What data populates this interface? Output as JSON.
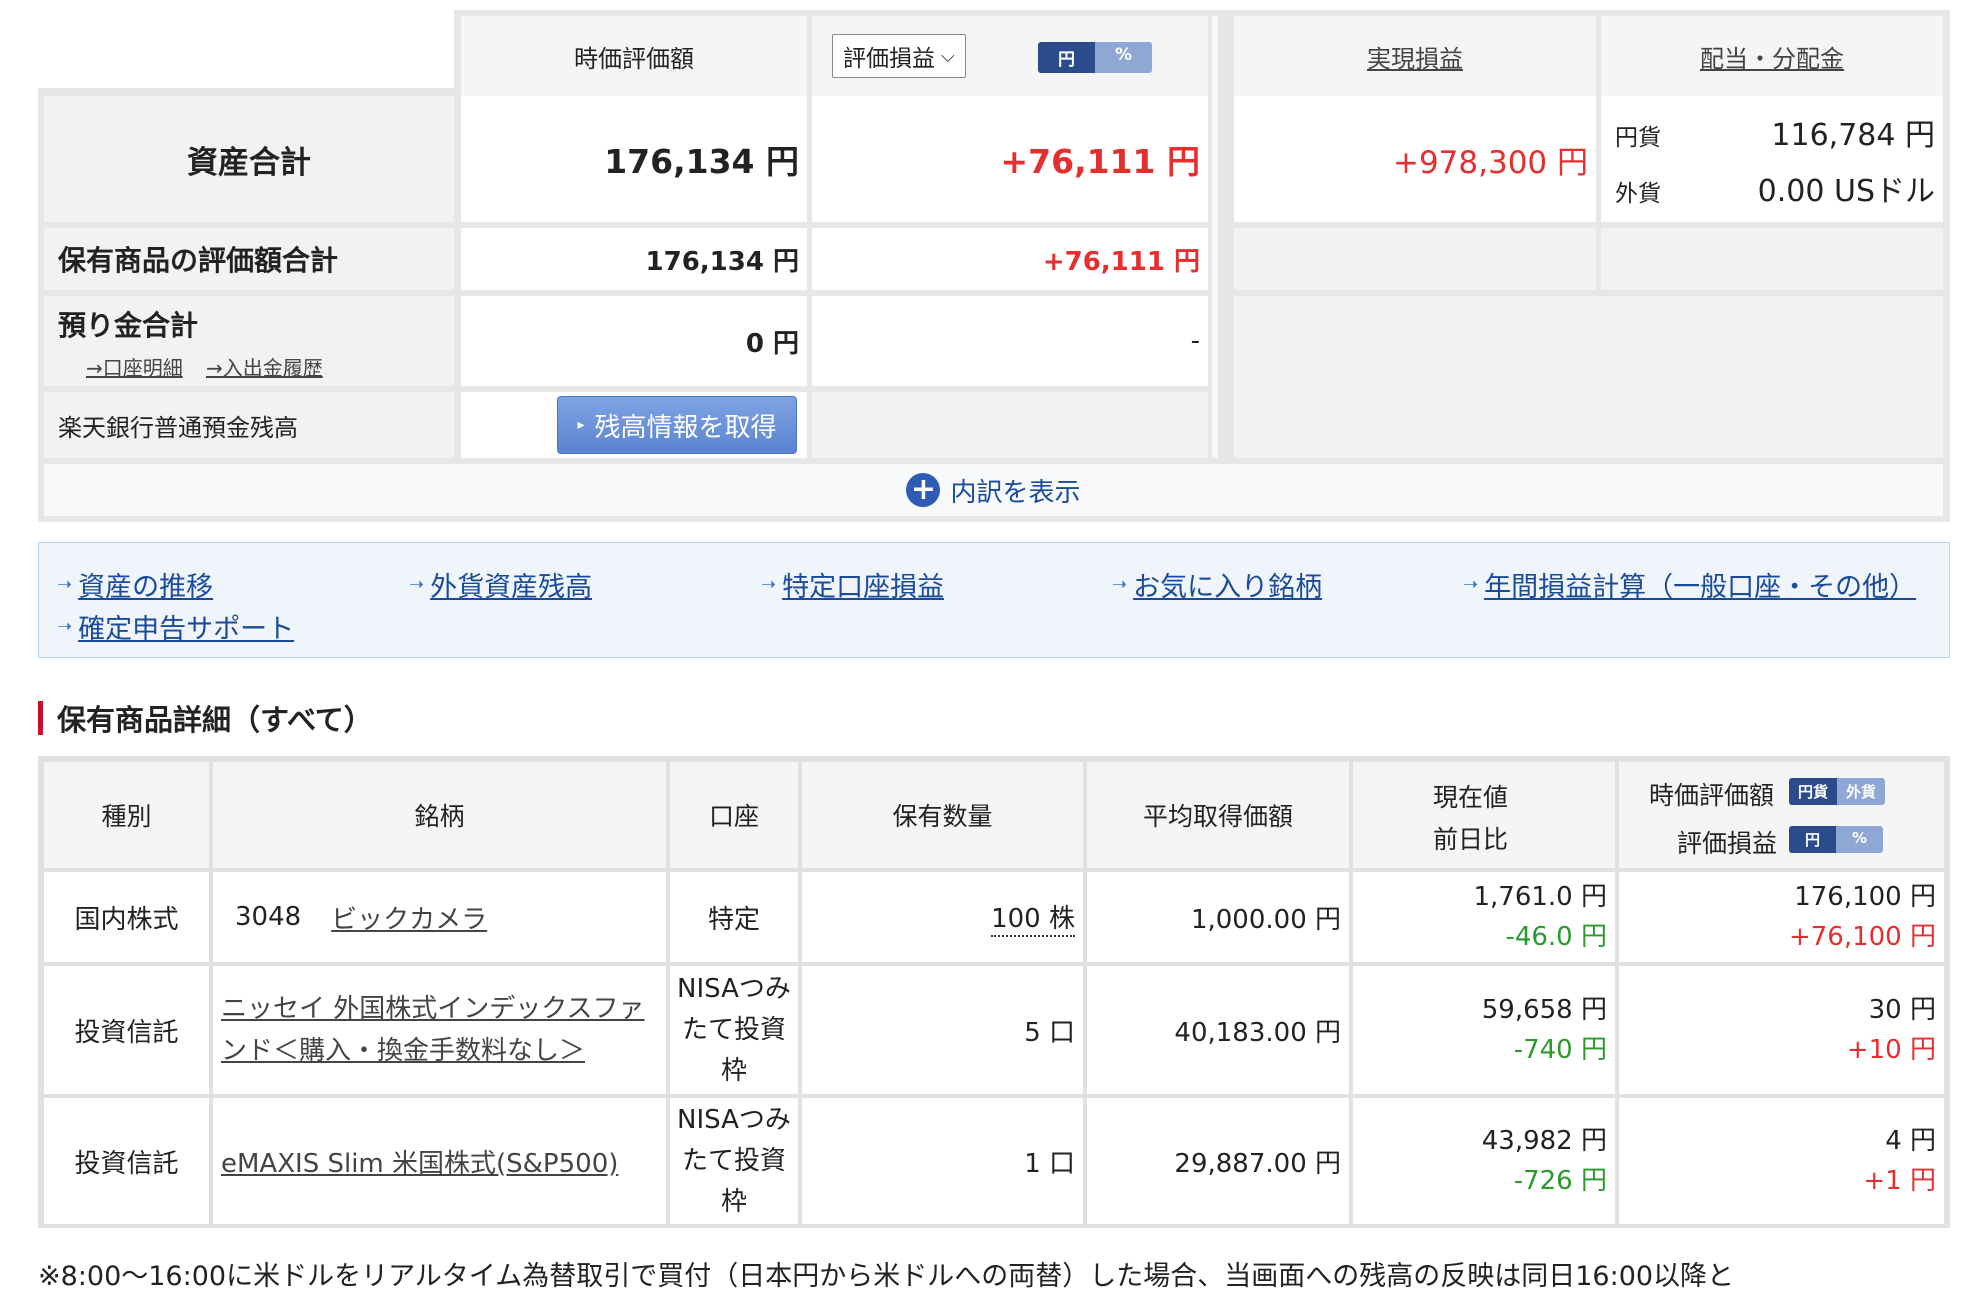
{
  "summary": {
    "header": {
      "market_value": "時価評価額",
      "pl_select": "評価損益",
      "toggle_yen": "円",
      "toggle_pct": "%",
      "realized": "実現損益",
      "dividends": "配当・分配金"
    },
    "total": {
      "label": "資産合計",
      "value": "176,134 円",
      "pl": "+76,111 円",
      "realized": "+978,300 円",
      "div_jpy_label": "円貨",
      "div_jpy_value": "116,784 円",
      "div_fx_label": "外貨",
      "div_fx_value": "0.00 USドル"
    },
    "holdings_total": {
      "label": "保有商品の評価額合計",
      "value": "176,134 円",
      "pl": "+76,111 円"
    },
    "cash": {
      "label": "預り金合計",
      "link1": "→口座明細",
      "link2": "→入出金履歴",
      "value": "0 円",
      "pl": "-"
    },
    "bank": {
      "label": "楽天銀行普通預金残高",
      "button": "残高情報を取得"
    },
    "expand": "内訳を表示"
  },
  "links": [
    "資産の推移",
    "外貨資産残高",
    "特定口座損益",
    "お気に入り銘柄",
    "年間損益計算（一般口座・その他）",
    "確定申告サポート"
  ],
  "section_title": "保有商品詳細（すべて）",
  "table": {
    "headers": {
      "type": "種別",
      "name": "銘柄",
      "account": "口座",
      "qty": "保有数量",
      "avg": "平均取得価額",
      "price": "現在値",
      "change": "前日比",
      "mv": "時価評価額",
      "mv_t1": "円貨",
      "mv_t2": "外貨",
      "pl": "評価損益",
      "pl_t1": "円",
      "pl_t2": "%"
    },
    "rows": [
      {
        "type": "国内株式",
        "code": "3048",
        "name": "ビックカメラ",
        "account": "特定",
        "qty": "100 株",
        "avg": "1,000.00 円",
        "price": "1,761.0 円",
        "change": "-46.0 円",
        "mv": "176,100 円",
        "pl": "+76,100 円"
      },
      {
        "type": "投資信託",
        "code": "",
        "name": "ニッセイ 外国株式インデックスファンド＜購入・換金手数料なし＞",
        "account": "NISAつみたて投資枠",
        "qty": "5 口",
        "avg": "40,183.00 円",
        "price": "59,658 円",
        "change": "-740 円",
        "mv": "30 円",
        "pl": "+10 円"
      },
      {
        "type": "投資信託",
        "code": "",
        "name": "eMAXIS Slim 米国株式(S&P500)",
        "account": "NISAつみたて投資枠",
        "qty": "1 口",
        "avg": "29,887.00 円",
        "price": "43,982 円",
        "change": "-726 円",
        "mv": "4 円",
        "pl": "+1 円"
      }
    ]
  },
  "footnote": "※8:00～16:00に米ドルをリアルタイム為替取引で買付（日本円から米ドルへの両替）した場合、当画面への残高の反映は同日16:00以降と",
  "colors": {
    "profit": "#e52e2e",
    "loss": "#2a9a2a",
    "link": "#1a4b9b",
    "accent": "#c8102e"
  }
}
